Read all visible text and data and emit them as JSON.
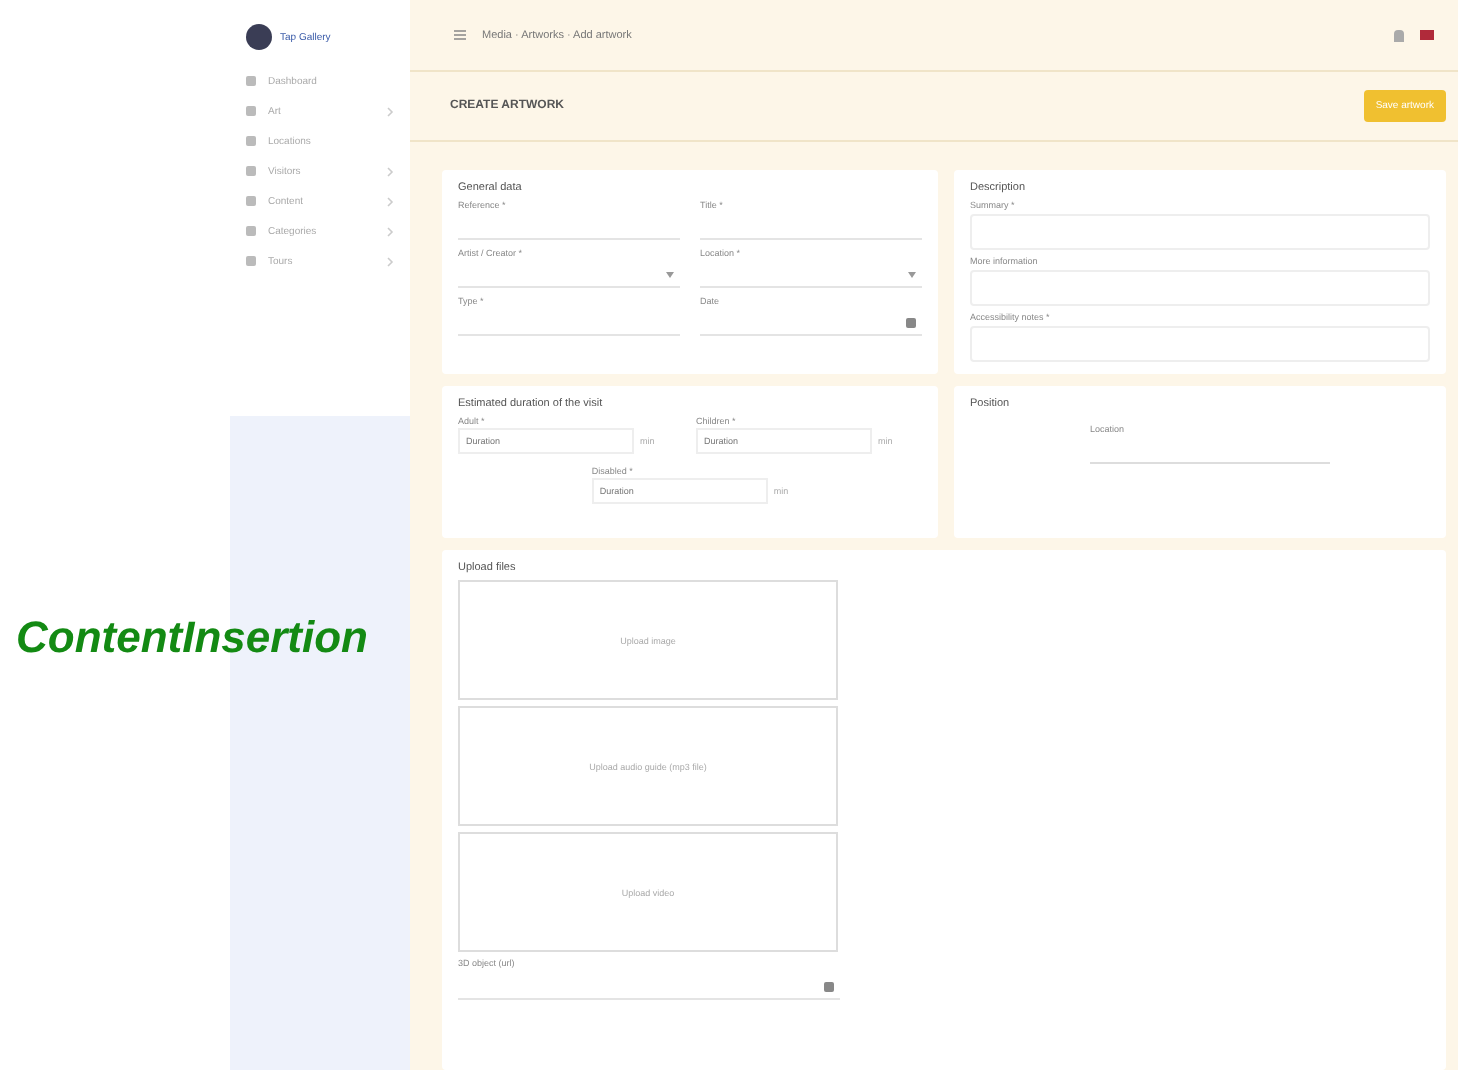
{
  "overlay_caption": "ContentInsertion",
  "sidebar": {
    "brand": "Tap Gallery",
    "items": [
      {
        "label": "Dashboard",
        "has_submenu": false
      },
      {
        "label": "Art",
        "has_submenu": true
      },
      {
        "label": "Locations",
        "has_submenu": false
      },
      {
        "label": "Visitors",
        "has_submenu": true
      },
      {
        "label": "Content",
        "has_submenu": true
      },
      {
        "label": "Categories",
        "has_submenu": true
      },
      {
        "label": "Tours",
        "has_submenu": true
      }
    ]
  },
  "breadcrumb": "Media · Artworks · Add artwork",
  "page_title": "CREATE ARTWORK",
  "save_button": "Save artwork",
  "general": {
    "title": "General data",
    "fields": [
      {
        "label": "Reference *",
        "kind": "text"
      },
      {
        "label": "Title *",
        "kind": "text"
      },
      {
        "label": "Artist / Creator *",
        "kind": "select"
      },
      {
        "label": "Location *",
        "kind": "select"
      },
      {
        "label": "Type *",
        "kind": "text"
      },
      {
        "label": "Date",
        "kind": "date"
      }
    ]
  },
  "description": {
    "title": "Description",
    "fields": [
      {
        "label": "Summary *"
      },
      {
        "label": "More information"
      },
      {
        "label": "Accessibility notes *"
      }
    ]
  },
  "duration": {
    "title": "Estimated duration of the visit",
    "groups": [
      {
        "label": "Adult *",
        "unit": "min",
        "placeholder": "Duration"
      },
      {
        "label": "Children *",
        "unit": "min",
        "placeholder": "Duration"
      },
      {
        "label": "Disabled *",
        "unit": "min",
        "placeholder": "Duration"
      }
    ]
  },
  "position": {
    "title": "Position",
    "field": "Location"
  },
  "upload": {
    "title": "Upload files",
    "zones": [
      "Upload image",
      "Upload audio guide (mp3 file)",
      "Upload video"
    ],
    "field": "3D object (url)"
  }
}
